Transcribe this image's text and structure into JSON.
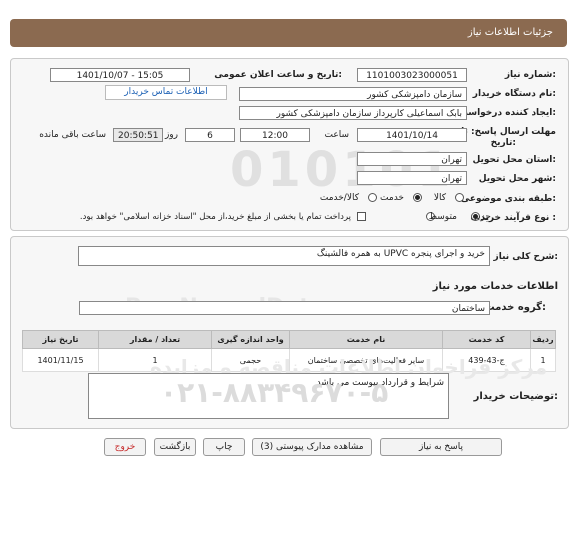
{
  "header": {
    "title": "جزئیات اطلاعات نیاز"
  },
  "form": {
    "need_number_label": "شماره نیاز:",
    "need_number": "1101003023000051",
    "announce_label": "تاریخ و ساعت اعلان عمومی:",
    "announce_value": "1401/10/07 - 15:05",
    "buyer_label": "نام دستگاه خریدار:",
    "buyer_value": "سازمان دامپزشکی کشور",
    "creator_label": "ایجاد کننده درخواست:",
    "creator_value": "بابک اسماعیلی کارپرداز سازمان دامپزشکی کشور",
    "contact_link": "اطلاعات تماس خریدار",
    "deadline_label": "مهلت ارسال پاسخ: تا",
    "deadline_label2": "تاریخ:",
    "deadline_date": "1401/10/14",
    "time_label": "ساعت",
    "deadline_time": "12:00",
    "days_value": "6",
    "days_label": "روز و",
    "remaining_value": "20:50:51",
    "remaining_label": "ساعت باقی مانده",
    "province_label": "استان محل تحویل:",
    "province_value": "تهران",
    "city_label": "شهر محل تحویل:",
    "city_value": "تهران",
    "category_label": "طبقه بندی موضوعی:",
    "category_options": [
      "کالا",
      "خدمت",
      "کالا/خدمت"
    ],
    "category_selected": "خدمت",
    "process_label": "نوع فرآیند خرید :",
    "process_options": [
      "جزیی",
      "متوسط"
    ],
    "process_selected": "جزیی",
    "payment_note": "پرداخت تمام یا بخشی از مبلغ خرید،از محل \"اسناد خزانه اسلامی\" خواهد بود."
  },
  "details": {
    "summary_label": "شرح کلی نیاز:",
    "summary_value": "خرید و اجرای پنجره UPVC به همره فالشینگ",
    "services_heading": "اطلاعات خدمات مورد نیاز",
    "group_label": "گروه خدمت:",
    "group_value": "ساختمان",
    "table": {
      "headers": [
        "ردیف",
        "کد خدمت",
        "نام خدمت",
        "واحد اندازه گیری",
        "تعداد / مقدار",
        "تاریخ نیاز"
      ],
      "rows": [
        [
          "1",
          "ج-43-439",
          "سایر فعالیت‌های تخصصی ساختمان",
          "حجمی",
          "1",
          "1401/11/15"
        ]
      ]
    },
    "buyer_notes_label": "توضیحات خریدار:",
    "buyer_notes_value": "شرایط و قرارداد پیوست می باشد"
  },
  "buttons": {
    "reply": "پاسخ به نیاز",
    "attachments": "مشاهده مدارک پیوستی (3)",
    "print": "چاپ",
    "back": "بازگشت",
    "exit": "خروج"
  },
  "watermark": {
    "line1": "ParsNamadData",
    "line2": "مرکز فراخوان اطلاعات مناقصه و مزایده",
    "line3": "۰۲۱-۸۸۳۴۹۶۷۰-۵"
  },
  "colors": {
    "header": "#8b6a50",
    "link": "#1a5fb4",
    "exit": "#c62828"
  }
}
